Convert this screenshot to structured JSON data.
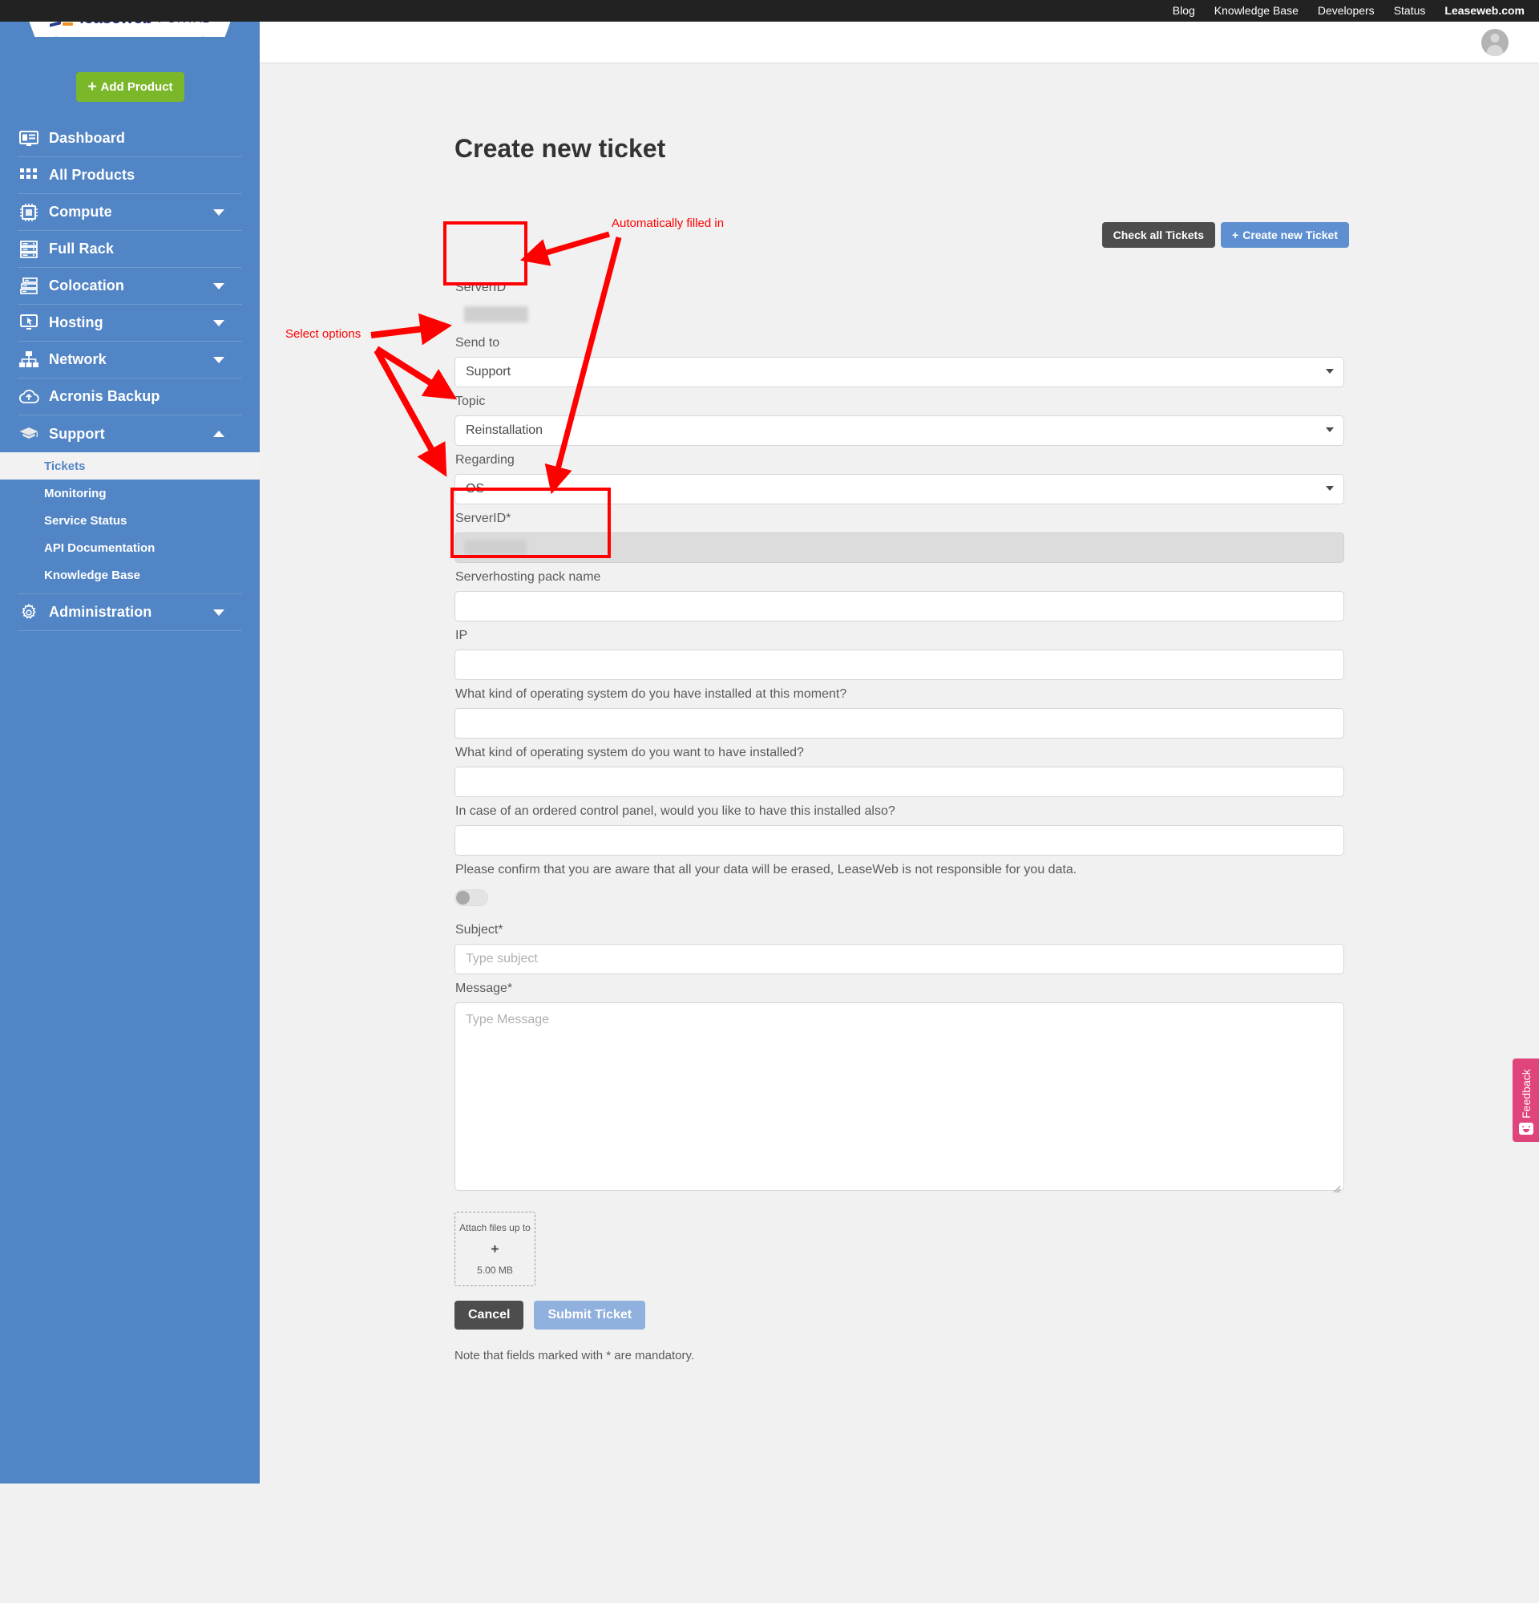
{
  "topbar": {
    "links": [
      {
        "label": "Blog",
        "strong": false
      },
      {
        "label": "Knowledge Base",
        "strong": false
      },
      {
        "label": "Developers",
        "strong": false
      },
      {
        "label": "Status",
        "strong": false
      },
      {
        "label": "Leaseweb.com",
        "strong": true
      }
    ]
  },
  "brand": {
    "name": "leaseweb",
    "suffix": "PORTAL",
    "logo_blue": "#2b3a8f",
    "logo_orange": "#f0901e"
  },
  "sidebar": {
    "accent": "#5285c5",
    "add_product_label": "Add Product",
    "add_product_color": "#7ab829",
    "items": [
      {
        "label": "Dashboard",
        "icon": "dashboard-icon",
        "caret": "none"
      },
      {
        "label": "All Products",
        "icon": "grid-icon",
        "caret": "none"
      },
      {
        "label": "Compute",
        "icon": "cpu-icon",
        "caret": "down"
      },
      {
        "label": "Full Rack",
        "icon": "rack-icon",
        "caret": "none"
      },
      {
        "label": "Colocation",
        "icon": "servers-icon",
        "caret": "down"
      },
      {
        "label": "Hosting",
        "icon": "monitor-icon",
        "caret": "down"
      },
      {
        "label": "Network",
        "icon": "network-icon",
        "caret": "down"
      },
      {
        "label": "Acronis Backup",
        "icon": "cloud-upload-icon",
        "caret": "none"
      },
      {
        "label": "Support",
        "icon": "graduation-cap-icon",
        "caret": "up"
      }
    ],
    "support_submenu": [
      {
        "label": "Tickets",
        "active": true
      },
      {
        "label": "Monitoring",
        "active": false
      },
      {
        "label": "Service Status",
        "active": false
      },
      {
        "label": "API Documentation",
        "active": false
      },
      {
        "label": "Knowledge Base",
        "active": false
      }
    ],
    "admin": {
      "label": "Administration",
      "icon": "gear-icon",
      "caret": "down"
    }
  },
  "main": {
    "title": "Create new ticket",
    "actions": {
      "check_all": "Check all Tickets",
      "create_new": "Create new Ticket",
      "create_new_plus": "+"
    }
  },
  "form": {
    "serverid_top_label": "ServerID",
    "send_to": {
      "label": "Send to",
      "value": "Support"
    },
    "topic": {
      "label": "Topic",
      "value": "Reinstallation"
    },
    "regarding": {
      "label": "Regarding",
      "value": "OS"
    },
    "serverid_required": {
      "label": "ServerID*",
      "value": ""
    },
    "pack_name": {
      "label": "Serverhosting pack name",
      "value": ""
    },
    "ip": {
      "label": "IP",
      "value": ""
    },
    "os_current": {
      "label": "What kind of operating system do you have installed at this moment?",
      "value": ""
    },
    "os_wanted": {
      "label": "What kind of operating system do you want to have installed?",
      "value": ""
    },
    "control_panel": {
      "label": "In case of an ordered control panel, would you like to have this installed also?",
      "value": ""
    },
    "confirm": {
      "label": "Please confirm that you are aware that all your data will be erased, LeaseWeb is not responsible for you data.",
      "checked": false
    },
    "subject": {
      "label": "Subject*",
      "placeholder": "Type subject",
      "value": ""
    },
    "message": {
      "label": "Message*",
      "placeholder": "Type Message",
      "value": ""
    },
    "attach": {
      "line1": "Attach files up to",
      "plus": "+",
      "size": "5.00 MB"
    },
    "cancel": "Cancel",
    "submit": "Submit Ticket",
    "note": "Note that fields marked with * are mandatory."
  },
  "annotations": {
    "color": "#ff0000",
    "auto_filled": "Automatically filled in",
    "select_options": "Select options"
  },
  "feedback": {
    "label": "Feedback",
    "color": "#e0447c"
  }
}
